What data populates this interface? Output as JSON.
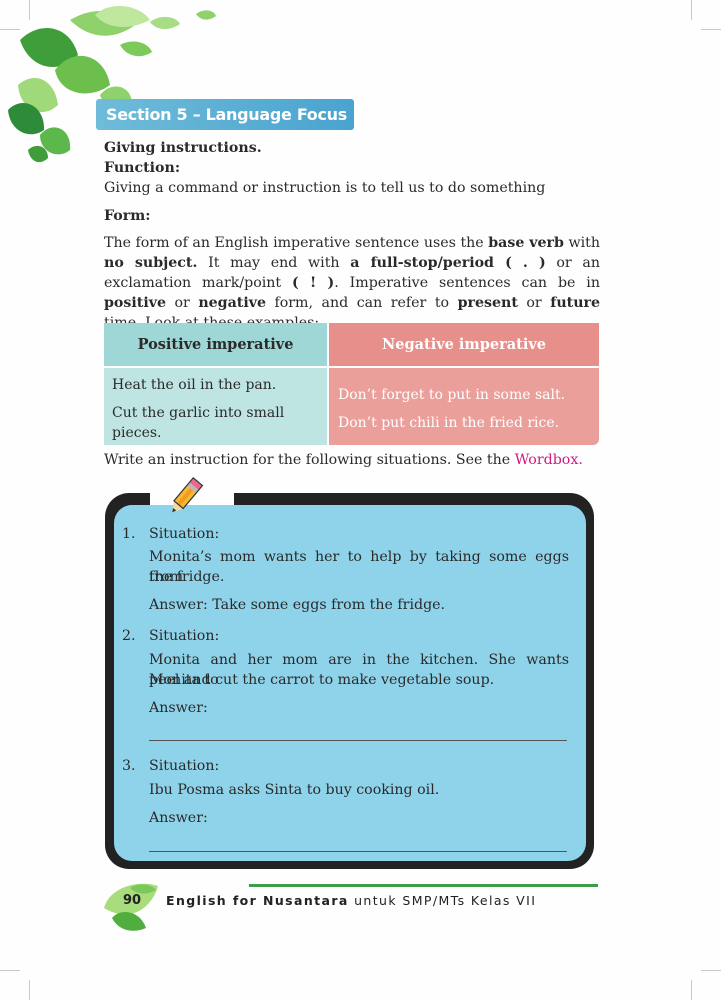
{
  "section_title": "Section 5 – Language Focus",
  "heading": "Giving instructions.",
  "function_label": "Function:",
  "function_text": "Giving a command or instruction is to tell us to do something",
  "form_label": "Form:",
  "form_paragraph": {
    "t1": "The form of an English imperative sentence uses the ",
    "b1": "base verb",
    "t2": " with ",
    "b2": "no subject.",
    "t3": " It may end with ",
    "b3": "a full-stop/period ( . )",
    "t4": " or an exclamation mark/point ",
    "b4": "( ! )",
    "t5": ". Imperative sentences can be in ",
    "b5": "positive",
    "t6": " or ",
    "b6": "negative",
    "t7": " form, and can refer to ",
    "b7": "present",
    "t8": " or ",
    "b8": "future",
    "t9": "  time. Look at these examples:"
  },
  "table": {
    "positive_header": "Positive imperative",
    "negative_header": "Negative imperative",
    "positive": [
      "Heat the oil in the pan.",
      "Cut the garlic into small",
      "pieces."
    ],
    "negative": [
      "Don’t forget to put in some salt.",
      "Don’t put chili in the fried rice."
    ]
  },
  "instruction": {
    "text": "Write an instruction for the following situations. See the ",
    "link": "Wordbox."
  },
  "exercises": [
    {
      "num": "1.",
      "label": "Situation:",
      "text": [
        "Monita’s mom wants her to help by taking some eggs from",
        "the fridge."
      ],
      "answer": "Answer: Take some eggs from the fridge."
    },
    {
      "num": "2.",
      "label": "Situation:",
      "text": [
        "Monita and her mom are in the kitchen. She wants Monita to",
        "peel and cut the carrot to make vegetable soup."
      ],
      "answer": "Answer:"
    },
    {
      "num": "3.",
      "label": "Situation:",
      "text": [
        "Ibu Posma asks Sinta to buy cooking oil."
      ],
      "answer": "Answer:"
    }
  ],
  "footer": {
    "page_number": "90",
    "book_title": "English for Nusantara",
    "book_subtitle": " untuk SMP/MTs Kelas VII"
  },
  "colors": {
    "section_title_bg": "#4aa3cf",
    "positive_header_bg": "#9ed7d5",
    "negative_header_bg": "#e78f8b",
    "exercise_bg": "#8fd3ea",
    "wordbox_link": "#d1197f",
    "footer_rule": "#3c9e47"
  },
  "icons": [
    "leaf-decoration-icon",
    "pencil-icon",
    "footer-leaf-icon"
  ]
}
